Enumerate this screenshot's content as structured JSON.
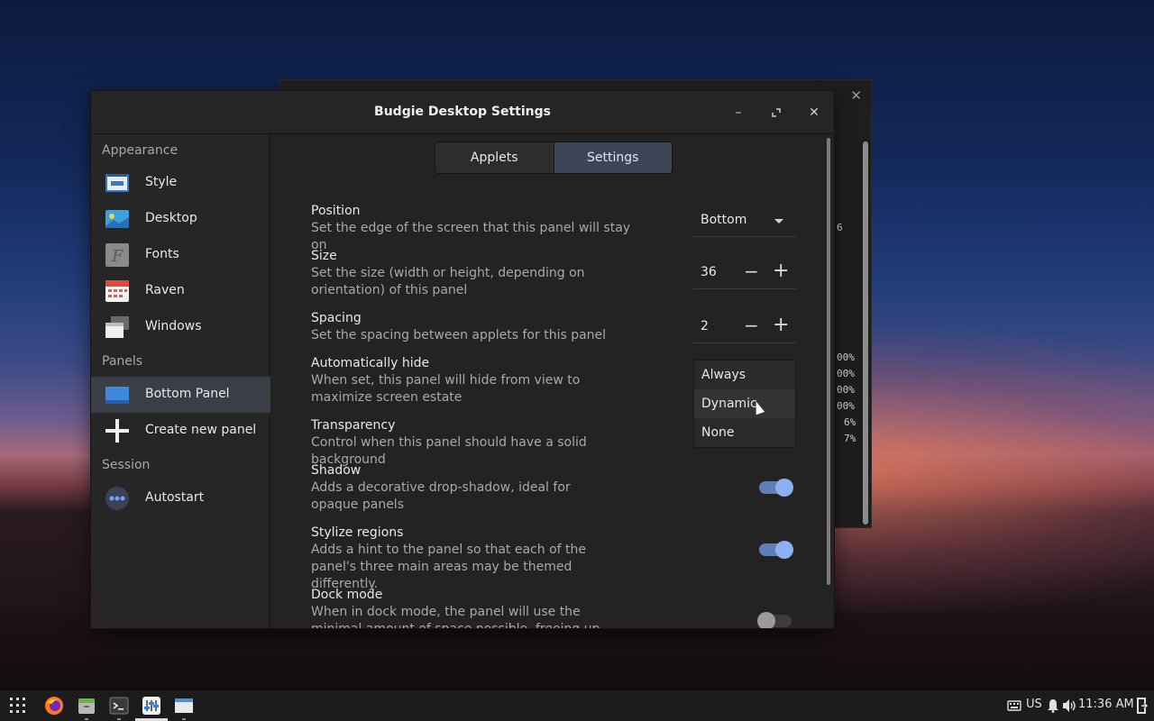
{
  "window": {
    "title": "Budgie Desktop Settings",
    "minimize_icon": "minimize-icon",
    "maximize_icon": "maximize-icon",
    "close_icon": "close-icon"
  },
  "sidebar": {
    "sections": [
      {
        "heading": "Appearance",
        "items": [
          {
            "label": "Style",
            "icon": "style-icon"
          },
          {
            "label": "Desktop",
            "icon": "desktop-icon"
          },
          {
            "label": "Fonts",
            "icon": "fonts-icon"
          },
          {
            "label": "Raven",
            "icon": "calendar-icon"
          },
          {
            "label": "Windows",
            "icon": "windows-icon"
          }
        ]
      },
      {
        "heading": "Panels",
        "items": [
          {
            "label": "Bottom Panel",
            "icon": "panel-icon",
            "active": true
          },
          {
            "label": "Create new panel",
            "icon": "plus-icon"
          }
        ]
      },
      {
        "heading": "Session",
        "items": [
          {
            "label": "Autostart",
            "icon": "autostart-icon"
          }
        ]
      }
    ]
  },
  "tabs": [
    {
      "label": "Applets",
      "selected": false
    },
    {
      "label": "Settings",
      "selected": true
    }
  ],
  "settings": [
    {
      "title": "Position",
      "desc": "Set the edge of the screen that this panel will stay on",
      "control": "combo",
      "value": "Bottom"
    },
    {
      "title": "Size",
      "desc": "Set the size (width or height, depending on orientation) of this panel",
      "control": "spin",
      "value": "36"
    },
    {
      "title": "Spacing",
      "desc": "Set the spacing between applets for this panel",
      "control": "spin",
      "value": "2"
    },
    {
      "title": "Automatically hide",
      "desc": "When set, this panel will hide from view to maximize screen estate",
      "control": "dropdown-open"
    },
    {
      "title": "Transparency",
      "desc": "Control when this panel should have a solid background"
    },
    {
      "title": "Shadow",
      "desc": "Adds a decorative drop-shadow, ideal for opaque panels",
      "control": "switch",
      "on": true
    },
    {
      "title": "Stylize regions",
      "desc": "Adds a hint to the panel so that each of the panel's three main areas may be themed differently.",
      "control": "switch",
      "on": true
    },
    {
      "title": "Dock mode",
      "desc": "When in dock mode, the panel will use the minimal amount of space possible, freeing up valuable screen",
      "control": "switch",
      "on": false
    }
  ],
  "dropdown": {
    "options": [
      "Always",
      "Dynamic",
      "None"
    ],
    "hovered": "Dynamic"
  },
  "background_window": {
    "close_icon": "close-icon",
    "lines": [
      "6",
      "00%",
      "00%",
      "00%",
      "00%",
      "6%",
      "7%"
    ]
  },
  "taskbar": {
    "apps": [
      "app-grid-icon",
      "firefox-icon",
      "files-icon",
      "terminal-icon",
      "budgie-settings-icon",
      "window-icon"
    ],
    "keyboard_layout": "US",
    "clock": "11:36 AM",
    "tray_icons": [
      "keyboard-icon",
      "notification-bell-icon",
      "volume-icon",
      "power-icon"
    ]
  }
}
